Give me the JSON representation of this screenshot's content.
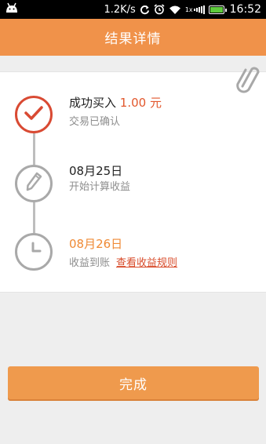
{
  "status_bar": {
    "speed": "1.2K/s",
    "network_label": "1x",
    "time": "16:52"
  },
  "header": {
    "title": "结果详情"
  },
  "steps": [
    {
      "title": "成功买入",
      "amount": "1.00 元",
      "subtitle": "交易已确认",
      "status": "done"
    },
    {
      "title": "08月25日",
      "subtitle": "开始计算收益",
      "status": "pending"
    },
    {
      "title": "08月26日",
      "subtitle": "收益到账",
      "link": "查看收益规则",
      "status": "pending"
    }
  ],
  "finish_button": {
    "label": "完成"
  },
  "colors": {
    "brand": "#f0924a",
    "done": "#d94a33",
    "highlight": "#ef8a35",
    "pending": "#a9a9a9"
  }
}
